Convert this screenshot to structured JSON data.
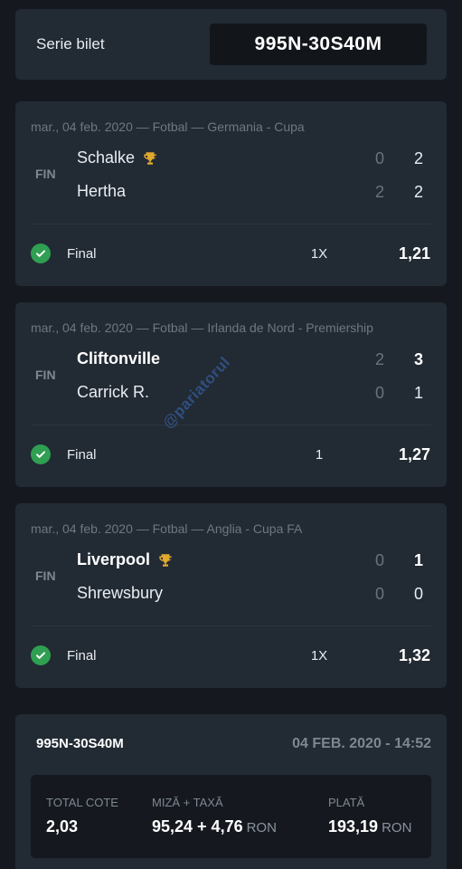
{
  "ticket": {
    "serie_label": "Serie bilet",
    "serie_code": "995N-30S40M"
  },
  "matches": [
    {
      "meta": "mar., 04 feb. 2020 — Fotbal — Germania - Cupa",
      "status": "FIN",
      "team1": "Schalke",
      "team1_trophy": true,
      "team2": "Hertha",
      "team1_half": "0",
      "team1_full": "2",
      "team2_half": "2",
      "team2_full": "2",
      "result": "Final",
      "pick": "1X",
      "odd": "1,21"
    },
    {
      "meta": "mar., 04 feb. 2020 — Fotbal — Irlanda de Nord - Premiership",
      "status": "FIN",
      "team1": "Cliftonville",
      "team1_trophy": false,
      "team2": "Carrick R.",
      "team1_half": "2",
      "team1_full": "3",
      "team2_half": "0",
      "team2_full": "1",
      "result": "Final",
      "pick": "1",
      "odd": "1,27"
    },
    {
      "meta": "mar., 04 feb. 2020 — Fotbal — Anglia - Cupa FA",
      "status": "FIN",
      "team1": "Liverpool",
      "team1_trophy": true,
      "team2": "Shrewsbury",
      "team1_half": "0",
      "team1_full": "1",
      "team2_half": "0",
      "team2_full": "0",
      "result": "Final",
      "pick": "1X",
      "odd": "1,32"
    }
  ],
  "summary": {
    "code": "995N-30S40M",
    "date": "04 FEB. 2020 - 14:52",
    "total_label": "TOTAL COTE",
    "total_value": "2,03",
    "stake_label": "MIZĂ + TAXĂ",
    "stake_value": "95,24 + 4,76",
    "payout_label": "PLATĂ",
    "payout_value": "193,19",
    "currency": "RON"
  },
  "watermark": "@pariatorul",
  "colors": {
    "background": "#15191f",
    "card": "#222a33",
    "check": "#2f9f52",
    "trophy": "#e0a82e"
  }
}
